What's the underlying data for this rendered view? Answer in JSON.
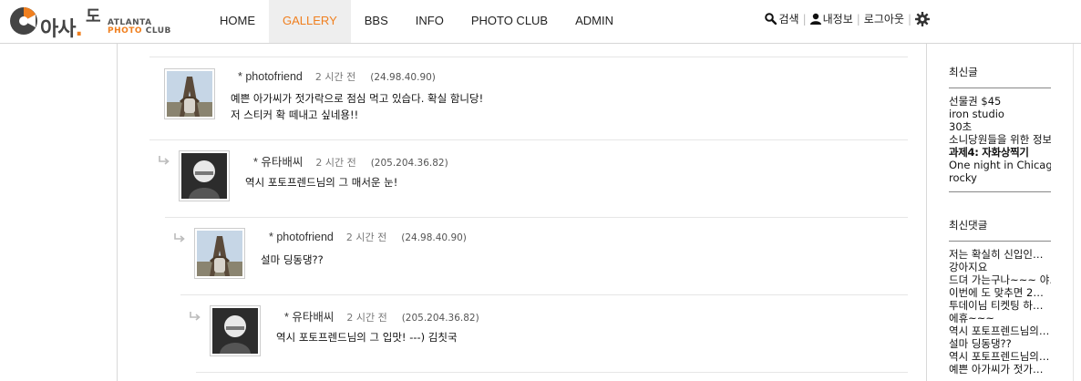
{
  "brand": {
    "logo_ko": "아사도",
    "logo_en_1": "ATLANTA",
    "logo_en_2a": "PHOTO",
    "logo_en_2b": " CLUB",
    "accent": "#f07f1e"
  },
  "nav": {
    "items": [
      {
        "label": "HOME"
      },
      {
        "label": "GALLERY",
        "active": true
      },
      {
        "label": "BBS"
      },
      {
        "label": "INFO"
      },
      {
        "label": "PHOTO CLUB"
      },
      {
        "label": "ADMIN"
      }
    ]
  },
  "util": {
    "search": "검색",
    "profile": "내정보",
    "logout": "로그아웃",
    "icons": [
      "search-icon",
      "user-icon",
      "gear-icon"
    ]
  },
  "comments": [
    {
      "author": "* photofriend",
      "time": "2 시간 전",
      "ip": "(24.98.40.90)",
      "lines": [
        "예쁜 아가씨가 젓가락으로 점심 먹고 있습다. 확실 함니당!",
        "저 스티커 확 떼내고 싶네용!!"
      ],
      "avatar": "eiffel"
    },
    {
      "author": "* 유타배씨",
      "time": "2 시간 전",
      "ip": "(205.204.36.82)",
      "lines": [
        "역시 포토프렌드님의 그 매서운 눈!"
      ],
      "avatar": "bw"
    },
    {
      "author": "* photofriend",
      "time": "2 시간 전",
      "ip": "(24.98.40.90)",
      "lines": [
        "설마 딩동댕??"
      ],
      "avatar": "eiffel"
    },
    {
      "author": "* 유타배씨",
      "time": "2 시간 전",
      "ip": "(205.204.36.82)",
      "lines": [
        "역시 포토프렌드님의 그 입맛! ---) 김칫국"
      ],
      "avatar": "bw"
    }
  ],
  "sidebar": {
    "recent_posts_title": "최신글",
    "recent_posts": [
      {
        "text": "선물권 $45"
      },
      {
        "text": "iron studio"
      },
      {
        "text": "30초"
      },
      {
        "text": "소니당원들을 위한 정보"
      },
      {
        "text": "과제4: 자화상찍기",
        "bold": true
      },
      {
        "text": "One night in Chicag…"
      },
      {
        "text": "rocky"
      }
    ],
    "recent_comments_title": "최신댓글",
    "recent_comments": [
      "저는 확실히 신입인…",
      "강아지요",
      "드뎌 가는구나~~~ 야…",
      "이번에 도 맞추면 2…",
      "투데이님 티켓팅 하…",
      "에휴~~~",
      "역시 포토프렌드님의…",
      "설마 딩동댕??",
      "역시 포토프렌드님의…",
      "예쁜 아가씨가 젓가…"
    ]
  }
}
